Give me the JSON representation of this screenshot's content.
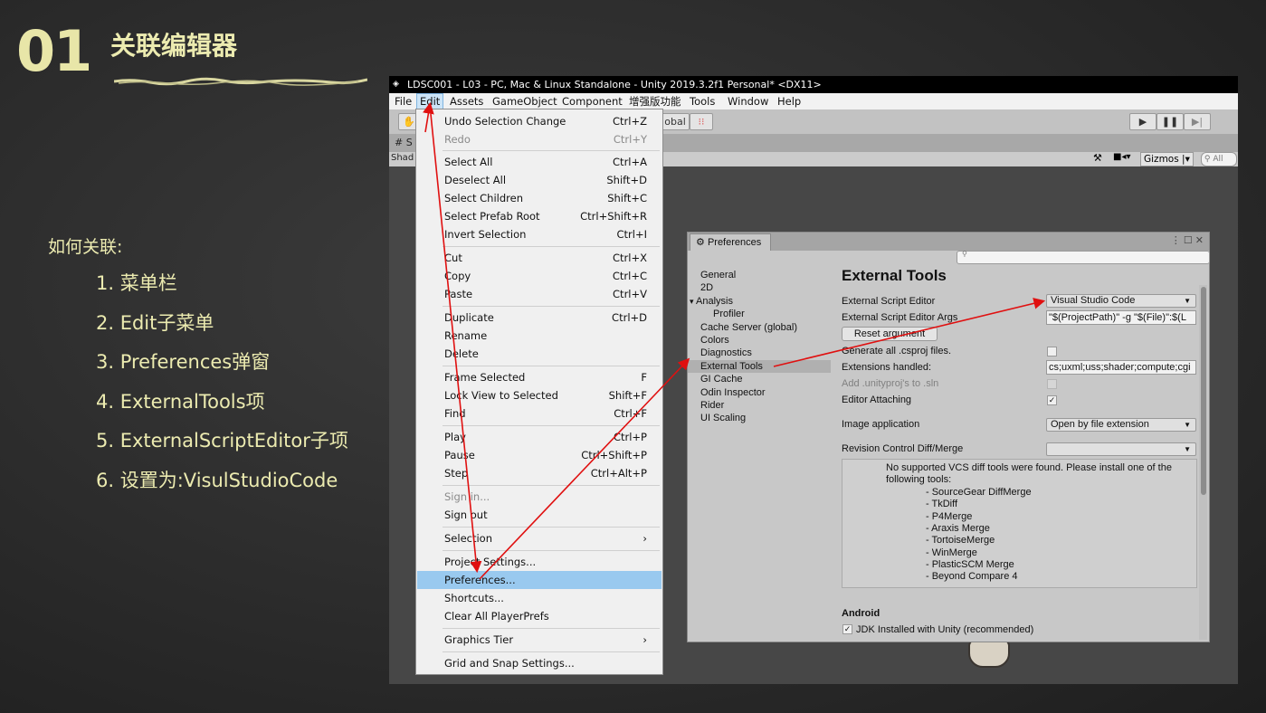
{
  "slide": {
    "number": "01",
    "title": "关联编辑器",
    "howto": "如何关联:",
    "steps": [
      "1. 菜单栏",
      "2. Edit子菜单",
      "3. Preferences弹窗",
      "4. ExternalTools项",
      "5. ExternalScriptEditor子项",
      "6. 设置为:VisulStudioCode"
    ]
  },
  "unity": {
    "window_title": "LDSC001 - L03 - PC, Mac & Linux Standalone - Unity 2019.3.2f1 Personal* <DX11>",
    "menu": [
      "File",
      "Edit",
      "Assets",
      "GameObject",
      "Component",
      "增强版功能",
      "Tools",
      "Window",
      "Help"
    ],
    "toolbar_partial": "obal",
    "tab_partial": "S",
    "shading_partial": "Shad",
    "gizmos": "Gizmos",
    "search_all": "All"
  },
  "edit_menu": {
    "items": [
      {
        "label": "Undo Selection Change",
        "shortcut": "Ctrl+Z"
      },
      {
        "label": "Redo",
        "shortcut": "Ctrl+Y",
        "disabled": true
      },
      {
        "label": "Select All",
        "shortcut": "Ctrl+A"
      },
      {
        "label": "Deselect All",
        "shortcut": "Shift+D"
      },
      {
        "label": "Select Children",
        "shortcut": "Shift+C"
      },
      {
        "label": "Select Prefab Root",
        "shortcut": "Ctrl+Shift+R"
      },
      {
        "label": "Invert Selection",
        "shortcut": "Ctrl+I"
      },
      {
        "label": "Cut",
        "shortcut": "Ctrl+X"
      },
      {
        "label": "Copy",
        "shortcut": "Ctrl+C"
      },
      {
        "label": "Paste",
        "shortcut": "Ctrl+V"
      },
      {
        "label": "Duplicate",
        "shortcut": "Ctrl+D"
      },
      {
        "label": "Rename",
        "shortcut": ""
      },
      {
        "label": "Delete",
        "shortcut": ""
      },
      {
        "label": "Frame Selected",
        "shortcut": "F"
      },
      {
        "label": "Lock View to Selected",
        "shortcut": "Shift+F"
      },
      {
        "label": "Find",
        "shortcut": "Ctrl+F"
      },
      {
        "label": "Play",
        "shortcut": "Ctrl+P"
      },
      {
        "label": "Pause",
        "shortcut": "Ctrl+Shift+P"
      },
      {
        "label": "Step",
        "shortcut": "Ctrl+Alt+P"
      },
      {
        "label": "Sign in...",
        "shortcut": "",
        "disabled": true
      },
      {
        "label": "Sign out",
        "shortcut": ""
      },
      {
        "label": "Selection",
        "shortcut": "›"
      },
      {
        "label": "Project Settings...",
        "shortcut": ""
      },
      {
        "label": "Preferences...",
        "shortcut": "",
        "highlighted": true
      },
      {
        "label": "Shortcuts...",
        "shortcut": ""
      },
      {
        "label": "Clear All PlayerPrefs",
        "shortcut": ""
      },
      {
        "label": "Graphics Tier",
        "shortcut": "›"
      },
      {
        "label": "Grid and Snap Settings...",
        "shortcut": ""
      }
    ]
  },
  "preferences": {
    "tab": "Preferences",
    "sidebar": [
      "General",
      "2D",
      "Analysis",
      "Profiler",
      "Cache Server (global)",
      "Colors",
      "Diagnostics",
      "External Tools",
      "GI Cache",
      "Odin Inspector",
      "Rider",
      "UI Scaling"
    ],
    "selected": "External Tools",
    "title": "External Tools",
    "labels": {
      "script_editor": "External Script Editor",
      "script_editor_args": "External Script Editor Args",
      "reset_argument": "Reset argument",
      "generate_csproj": "Generate all .csproj files.",
      "extensions_handled": "Extensions handled:",
      "add_unityproj": "Add .unityproj's to .sln",
      "editor_attaching": "Editor Attaching",
      "image_application": "Image application",
      "revision_control": "Revision Control Diff/Merge",
      "android": "Android",
      "jdk": "JDK Installed with Unity (recommended)"
    },
    "values": {
      "script_editor": "Visual Studio Code",
      "script_editor_args": "\"$(ProjectPath)\" -g \"$(File)\":$(L",
      "extensions": "cs;uxml;uss;shader;compute;cgi",
      "image_application": "Open by file extension",
      "revision_control": ""
    },
    "vcs_message": "No supported VCS diff tools were found. Please install one of the following tools:",
    "vcs_tools": [
      "- SourceGear DiffMerge",
      "- TkDiff",
      "- P4Merge",
      "- Araxis Merge",
      "- TortoiseMerge",
      "- WinMerge",
      "- PlasticSCM Merge",
      "- Beyond Compare 4"
    ]
  },
  "colors": {
    "slide_text": "#ecebb0",
    "arrow": "#e01010",
    "menu_highlight": "#99c9ef"
  }
}
